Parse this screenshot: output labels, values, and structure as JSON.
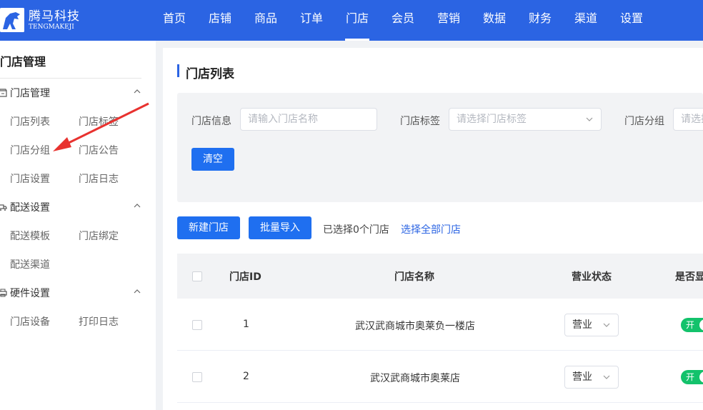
{
  "brand": {
    "name": "腾马科技",
    "subname": "TENGMAKEJI"
  },
  "nav": [
    "首页",
    "店铺",
    "商品",
    "订单",
    "门店",
    "会员",
    "营销",
    "数据",
    "财务",
    "渠道",
    "设置"
  ],
  "nav_active": "门店",
  "sidebar": {
    "title": "门店管理",
    "groups": [
      {
        "label": "门店管理",
        "icon": "store-icon",
        "items": [
          "门店列表",
          "门店标签",
          "门店分组",
          "门店公告",
          "门店设置",
          "门店日志"
        ]
      },
      {
        "label": "配送设置",
        "icon": "truck-icon",
        "items": [
          "配送模板",
          "门店绑定",
          "配送渠道"
        ]
      },
      {
        "label": "硬件设置",
        "icon": "printer-icon",
        "items": [
          "门店设备",
          "打印日志"
        ]
      }
    ]
  },
  "main": {
    "title": "门店列表",
    "filter": {
      "info_label": "门店信息",
      "info_placeholder": "请输入门店名称",
      "tag_label": "门店标签",
      "tag_placeholder": "请选择门店标签",
      "group_label": "门店分组",
      "group_placeholder": "请选择",
      "clear_label": "清空"
    },
    "toolbar": {
      "new_label": "新建门店",
      "import_label": "批量导入",
      "selected_text": "已选择0个门店",
      "select_all_label": "选择全部门店"
    },
    "table": {
      "headers": [
        "门店ID",
        "门店名称",
        "营业状态",
        "是否显"
      ],
      "rows": [
        {
          "id": "1",
          "name": "武汉武商城市奥莱负一楼店",
          "status": "营业",
          "switch": "开"
        },
        {
          "id": "2",
          "name": "武汉武商城市奥莱店",
          "status": "营业",
          "switch": "开"
        }
      ]
    }
  },
  "colors": {
    "primary": "#2b64e3",
    "button": "#1f6ff0",
    "switch_on": "#13c26b",
    "annotation": "#e8322f"
  }
}
